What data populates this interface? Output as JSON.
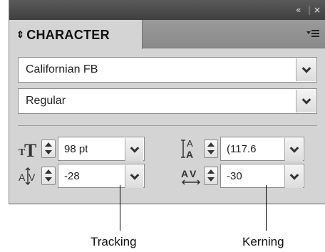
{
  "titlebar": {
    "collapse_icon": "«",
    "close_icon": "×"
  },
  "panel": {
    "tab_label": "CHARACTER"
  },
  "font_family": {
    "value": "Californian FB"
  },
  "font_style": {
    "value": "Regular"
  },
  "font_size": {
    "value": "98 pt"
  },
  "leading": {
    "value": "(117.6"
  },
  "tracking": {
    "value": "-28"
  },
  "kerning": {
    "value": "-30"
  },
  "callouts": {
    "tracking": "Tracking",
    "kerning": "Kerning"
  }
}
